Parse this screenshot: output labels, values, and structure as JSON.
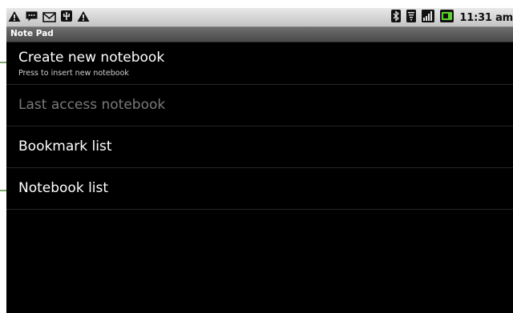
{
  "status_bar": {
    "notification_icons": [
      "warning-icon",
      "chat-icon",
      "gmail-icon",
      "usb-icon",
      "warning-icon"
    ],
    "system_icons": [
      "bluetooth-icon",
      "wifi-icon",
      "signal-icon",
      "battery-icon"
    ],
    "time": "11:31 am"
  },
  "title_bar": {
    "title": "Note Pad"
  },
  "menu": {
    "items": [
      {
        "label": "Create new notebook",
        "sublabel": "Press to insert new notebook",
        "enabled": true
      },
      {
        "label": "Last access notebook",
        "enabled": false
      },
      {
        "label": "Bookmark list",
        "enabled": true
      },
      {
        "label": "Notebook list",
        "enabled": true
      }
    ]
  },
  "colors": {
    "background": "#000000",
    "text": "#ffffff",
    "disabled_text": "#7a7a7a",
    "divider": "#262626",
    "title_bar": "#5a5a5a",
    "status_bar": "#d6d6d6",
    "callout_line": "#7faa6a"
  }
}
